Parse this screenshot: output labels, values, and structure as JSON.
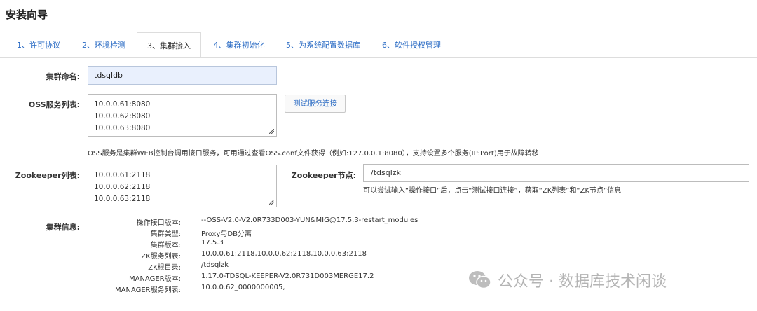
{
  "page": {
    "title": "安装向导"
  },
  "tabs": [
    {
      "label": "1、许可协议",
      "active": false
    },
    {
      "label": "2、环境检测",
      "active": false
    },
    {
      "label": "3、集群接入",
      "active": true
    },
    {
      "label": "4、集群初始化",
      "active": false
    },
    {
      "label": "5、为系统配置数据库",
      "active": false
    },
    {
      "label": "6、软件授权管理",
      "active": false
    }
  ],
  "form": {
    "cluster_name_label": "集群命名:",
    "cluster_name_value": "tdsqldb",
    "oss_label": "OSS服务列表:",
    "oss_lines": [
      "10.0.0.61:8080",
      "10.0.0.62:8080",
      "10.0.0.63:8080"
    ],
    "test_button": "测试服务连接",
    "oss_hint": "OSS服务是集群WEB控制台调用接口服务，可用通过查看OSS.conf文件获得（例如:127.0.0.1:8080），支持设置多个服务(IP:Port)用于故障转移",
    "zk_label": "Zookeeper列表:",
    "zk_lines": [
      "10.0.0.61:2118",
      "10.0.0.62:2118",
      "10.0.0.63:2118"
    ],
    "zk_node_label": "Zookeeper节点:",
    "zk_node_value": "/tdsqlzk",
    "zk_hint": "可以尝试输入“操作接口”后，点击“测试接口连接”，获取“ZK列表”和“ZK节点”信息",
    "cluster_info_label": "集群信息:"
  },
  "cluster_info": [
    {
      "key": "操作接口版本:",
      "value": "--OSS-V2.0-V2.0R733D003-YUN&MIG@17.5.3-restart_modules"
    },
    {
      "key": "集群类型:",
      "value": "Proxy与DB分离"
    },
    {
      "key": "集群版本:",
      "value": "17.5.3"
    },
    {
      "key": "ZK服务列表:",
      "value": "10.0.0.61:2118,10.0.0.62:2118,10.0.0.63:2118"
    },
    {
      "key": "ZK根目录:",
      "value": "/tdsqlzk"
    },
    {
      "key": "MANAGER版本:",
      "value": "1.17.0-TDSQL-KEEPER-V2.0R731D003MERGE17.2"
    },
    {
      "key": "MANAGER服务列表:",
      "value": "10.0.0.62_0000000005,"
    }
  ],
  "watermark": {
    "text": "公众号 · 数据库技术闲谈",
    "icon": "wechat-icon"
  }
}
